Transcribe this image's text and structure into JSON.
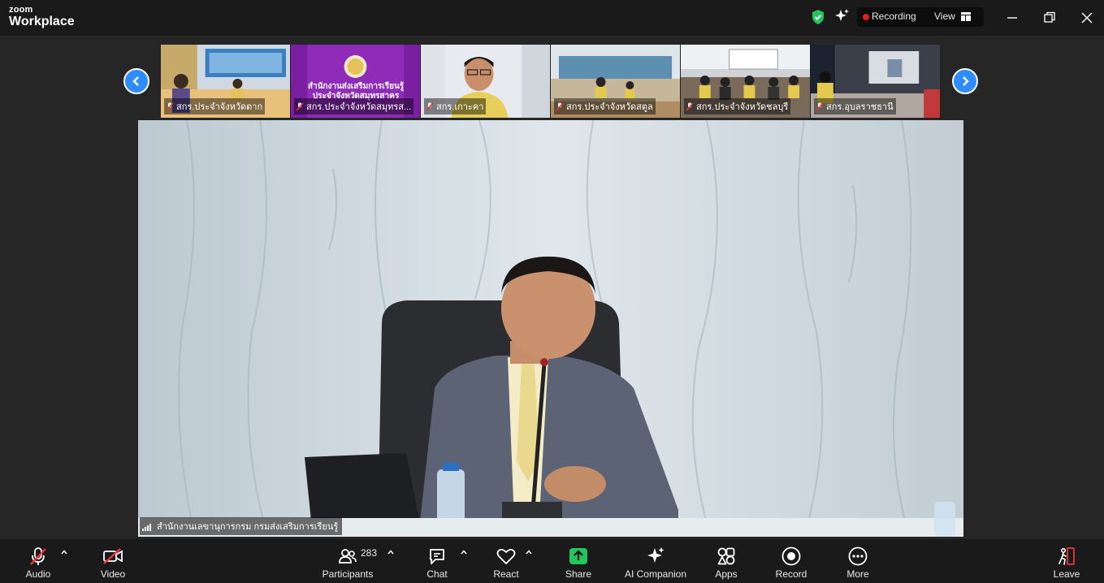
{
  "app": {
    "logo_top": "zoom",
    "logo_bottom": "Workplace"
  },
  "status": {
    "recording_label": "Recording",
    "view_label": "View"
  },
  "gallery": {
    "tiles": [
      {
        "name": "สกร.ประจำจังหวัดตาก",
        "muted": true
      },
      {
        "name": "สกร.ประจำจังหวัดสมุทรส...",
        "muted": true,
        "card_line1": "สำนักงานส่งเสริมการเรียนรู้",
        "card_line2": "ประจำจังหวัดสมุทรสาคร"
      },
      {
        "name": "สกร.เกาะคา",
        "muted": true
      },
      {
        "name": "สกร.ประจำจังหวัดสตูล",
        "muted": true
      },
      {
        "name": "สกร.ประจำจังหวัดชลบุรี",
        "muted": true
      },
      {
        "name": "สกร.อุบลราชธานี",
        "muted": true
      }
    ]
  },
  "main_speaker": {
    "name": "สำนักงานเลขานุการกรม กรมส่งเสริมการเรียนรู้"
  },
  "toolbar": {
    "audio": "Audio",
    "video": "Video",
    "participants": "Participants",
    "participant_count": "283",
    "chat": "Chat",
    "react": "React",
    "share": "Share",
    "ai_companion": "AI Companion",
    "apps": "Apps",
    "record": "Record",
    "more": "More",
    "leave": "Leave"
  },
  "colors": {
    "accent": "#2d8cff",
    "share": "#22c55e",
    "recording": "#e02020",
    "leave": "#e5363d"
  }
}
